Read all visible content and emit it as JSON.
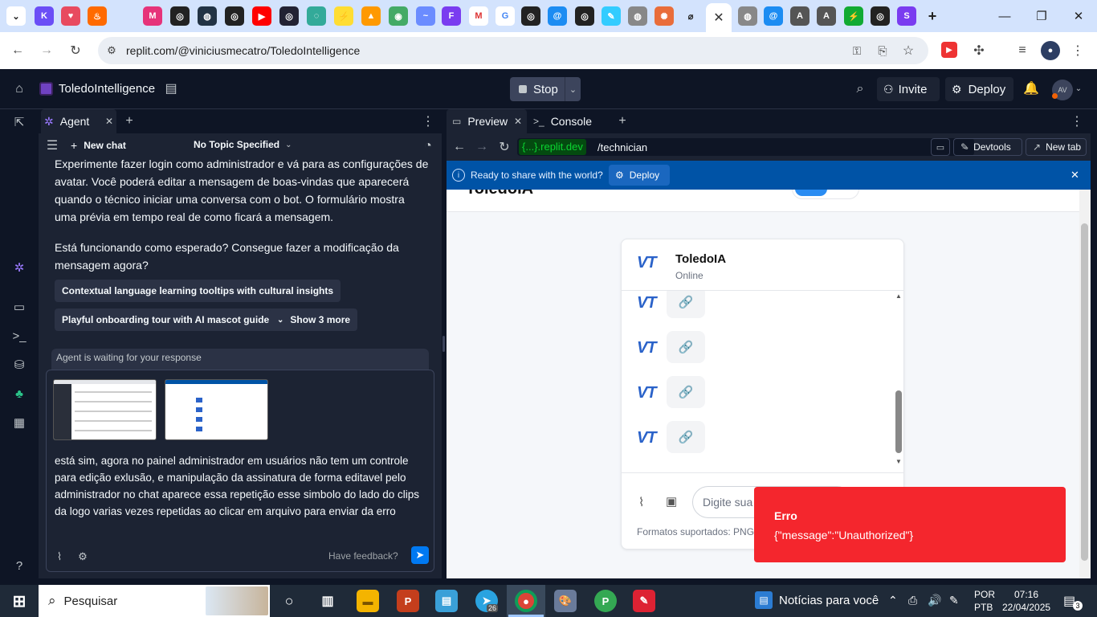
{
  "browser": {
    "tab_close": "✕",
    "new_tab": "+",
    "url": "replit.com/@viniciusmecatro/ToledoIntelligence"
  },
  "header": {
    "project_name": "ToledoIntelligence",
    "stop_label": "Stop",
    "invite_label": "Invite",
    "deploy_label": "Deploy",
    "avatar_initials": "AV"
  },
  "agent": {
    "tab_label": "Agent",
    "new_chat": "New chat",
    "topic": "No Topic Specified",
    "message_paragraph_1": "Experimente fazer login como administrador e vá para as configurações de avatar. Você poderá editar a mensagem de boas-vindas que aparecerá quando o técnico iniciar uma conversa com o bot. O formulário mostra uma prévia em tempo real de como ficará a mensagem.",
    "message_paragraph_2": "Está funcionando como esperado? Consegue fazer a modificação da mensagem agora?",
    "suggestions": [
      "Contextual language learning tooltips with cultural insights",
      "Playful onboarding tour with AI mascot guide"
    ],
    "show_more": "Show 3 more",
    "waiting": "Agent is waiting for your response",
    "input_text": "está sim, agora no painel administrador em usuários não tem um controle para edição exlusão, e manipulação da assinatura de forma editavel pelo administrador no chat aparece essa repetição esse simbolo do lado do clips da logo varias vezes repetidas ao clicar em arquivo para enviar da erro",
    "feedback": "Have feedback?"
  },
  "preview": {
    "tab_preview": "Preview",
    "tab_console": "Console",
    "domain": "{...}.replit.dev",
    "path": "/technician",
    "devtools": "Devtools",
    "new_tab": "New tab",
    "share_text": "Ready to share with the world?",
    "share_deploy": "Deploy",
    "page_brand": "ToledoIA",
    "chat_logo": "VT",
    "chat_title": "ToledoIA",
    "chat_status": "Online",
    "input_placeholder": "Digite sua",
    "formats": "Formatos suportados: PNG,"
  },
  "toast": {
    "title": "Erro",
    "message": "{\"message\":\"Unauthorized\"}"
  },
  "taskbar": {
    "search": "Pesquisar",
    "news": "Notícias para você",
    "lang1": "POR",
    "lang2": "PTB",
    "time": "07:16",
    "date": "22/04/2025",
    "notif_count": "3",
    "telegram_badge": "26"
  },
  "colors": {
    "replit_bg": "#0e1525",
    "panel_bg": "#1c2333",
    "share_bar": "#0053a6",
    "toast_red": "#f4262d",
    "accent_blue": "#2a62c9"
  }
}
